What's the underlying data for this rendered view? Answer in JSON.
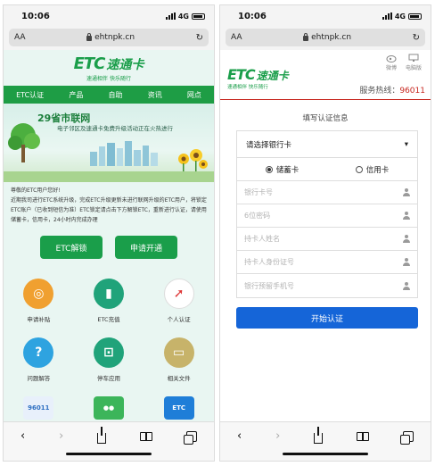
{
  "status_bar": {
    "time": "10:06",
    "network": "4G"
  },
  "browser": {
    "text_size": "AA",
    "url": "ehtnpk.cn",
    "reload_icon": "reload-icon"
  },
  "brand": {
    "logo_etc": "ETC",
    "logo_cn": "速通卡",
    "slogan": "速通相伴 快乐随行",
    "color": "#1a9e4a"
  },
  "left": {
    "nav": [
      "ETC认证",
      "产品",
      "自助",
      "资讯",
      "网点"
    ],
    "banner": {
      "title": "29省市联网",
      "subtitle": "电子邻区及速通卡免费升级活动正在火热进行"
    },
    "notice": {
      "greeting": "尊敬的ETC用户您好!",
      "body": "近期我司进行ETC系统升级，完成ETC升级更新未进行联网升级的ETC用户，将锁定ETC账户（已收到短信为准）ETC锁定请点击下方解锁ETC，重新进行认证，请使用储蓄卡，信用卡，24小时内完成办理"
    },
    "cta": {
      "unlock": "ETC解锁",
      "apply": "申请开通"
    },
    "grid": [
      {
        "label": "申请补贴",
        "icon": "coin-icon",
        "color": "#f0a030"
      },
      {
        "label": "ETC充值",
        "icon": "card-icon",
        "color": "#20a37a"
      },
      {
        "label": "个人认证",
        "icon": "compass-icon",
        "color": "#ffffff"
      },
      {
        "label": "问题解答",
        "icon": "question-icon",
        "color": "#2ea3e0"
      },
      {
        "label": "停车应用",
        "icon": "car-icon",
        "color": "#20a37a"
      },
      {
        "label": "相关文件",
        "icon": "book-icon",
        "color": "#c7b36a"
      },
      {
        "label": "",
        "icon": "hotline-96011-icon",
        "tile_text": "96011",
        "color": "#2e6fc2"
      },
      {
        "label": "",
        "icon": "wechat-icon",
        "color": "#3cb55a"
      },
      {
        "label": "",
        "icon": "etc-card-icon",
        "tile_text": "ETC",
        "color": "#1f7ed8"
      }
    ]
  },
  "right": {
    "social": {
      "weibo": "微博",
      "pc": "电脑版"
    },
    "hotline_label": "服务热线：",
    "hotline_number": "96011",
    "form_title": "填写认证信息",
    "bank_select": "请选择银行卡",
    "card_types": {
      "debit": "储蓄卡",
      "credit": "信用卡"
    },
    "fields": {
      "card_no": "银行卡号",
      "pin": "6位密码",
      "name": "持卡人姓名",
      "id_no": "持卡人身份证号",
      "phone": "银行预留手机号"
    },
    "submit": "开始认证",
    "accent_red": "#c7261e",
    "button_blue": "#1565d8"
  }
}
